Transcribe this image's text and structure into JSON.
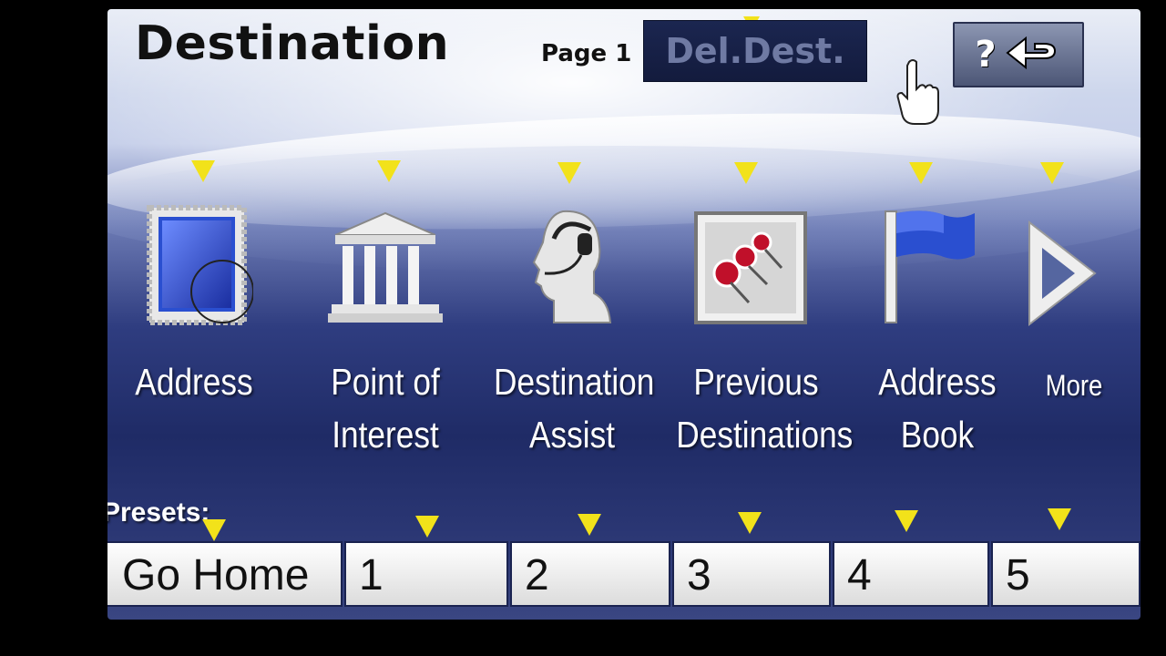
{
  "header": {
    "title": "Destination",
    "page_label": "Page 1",
    "del_dest_label": "Del.Dest.",
    "help_label": "?"
  },
  "menu": {
    "items": [
      {
        "line1": "Address",
        "line2": "",
        "icon": "address-stamp-icon"
      },
      {
        "line1": "Point of",
        "line2": "Interest",
        "icon": "building-icon"
      },
      {
        "line1": "Destination",
        "line2": "Assist",
        "icon": "operator-headset-icon"
      },
      {
        "line1": "Previous",
        "line2": "Destinations",
        "icon": "pins-icon"
      },
      {
        "line1": "Address",
        "line2": "Book",
        "icon": "flag-icon"
      },
      {
        "line1": "More",
        "line2": "",
        "icon": "play-arrow-icon"
      }
    ]
  },
  "presets": {
    "label": "Presets:",
    "buttons": [
      "Go Home",
      "1",
      "2",
      "3",
      "4",
      "5"
    ]
  },
  "colors": {
    "indicator": "#f2e21a",
    "button_dark": "#131b3d",
    "screen_dark": "#1f2b66"
  }
}
